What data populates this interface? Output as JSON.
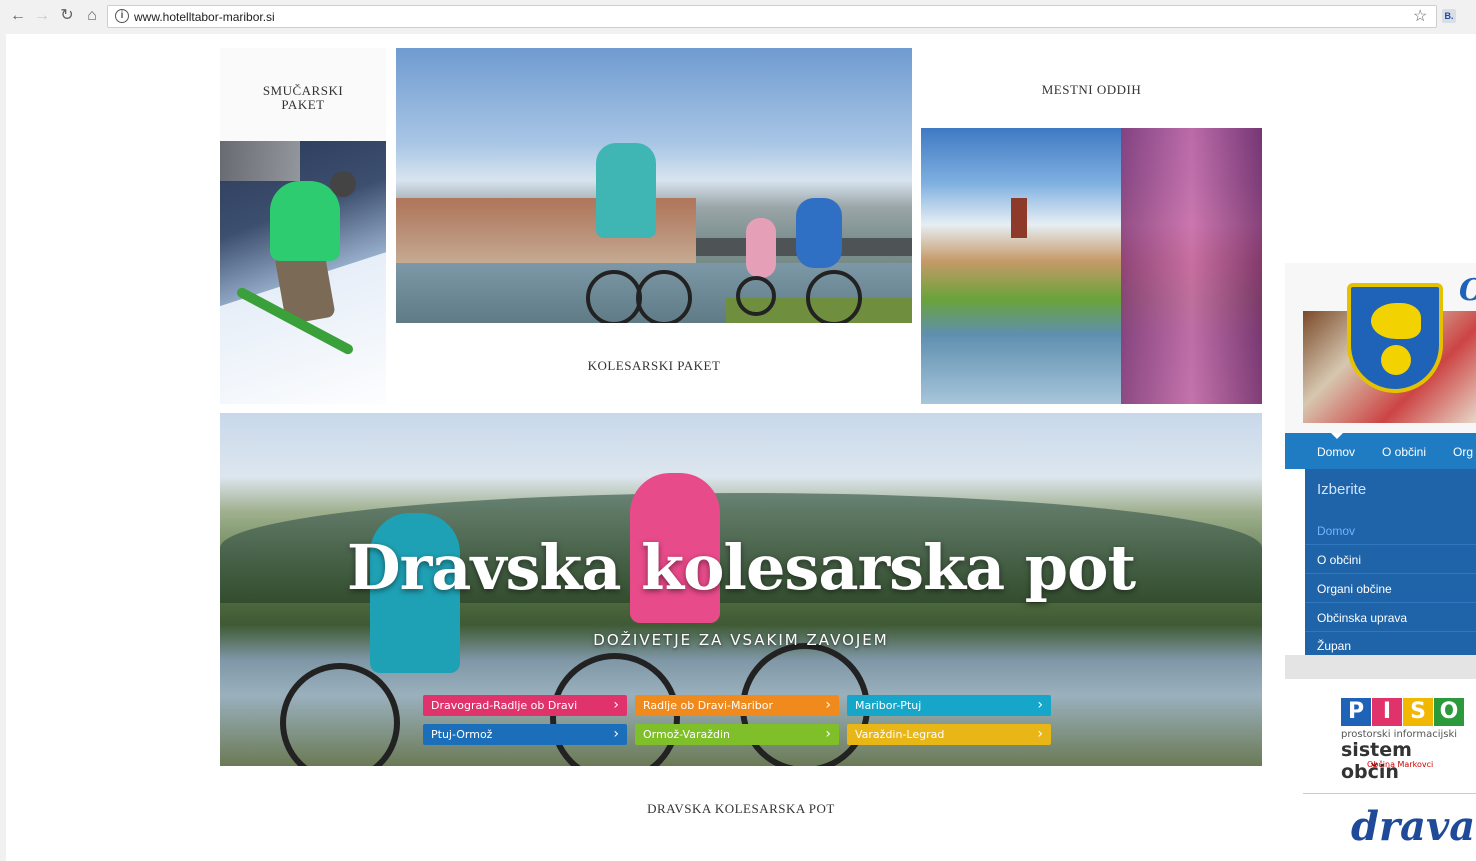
{
  "browser": {
    "url": "www.hotelltabor-maribor.si",
    "extension_label": "B."
  },
  "cards": {
    "ski": {
      "title": "SMUČARSKI\nPAKET"
    },
    "bike": {
      "title": "KOLESARSKI PAKET"
    },
    "town": {
      "title": "MESTNI ODDIH"
    },
    "drava": {
      "banner_title": "Dravska kolesarska pot",
      "banner_subtitle": "DOŽIVETJE ZA VSAKIM ZAVOJEM",
      "caption": "DRAVSKA KOLESARSKA POT",
      "routes": [
        {
          "label": "Dravograd-Radlje ob Dravi",
          "color": "#e0336b"
        },
        {
          "label": "Radlje ob Dravi-Maribor",
          "color": "#f08a1c"
        },
        {
          "label": "Maribor-Ptuj",
          "color": "#16a6c9"
        },
        {
          "label": "Ptuj-Ormož",
          "color": "#1b6fba"
        },
        {
          "label": "Ormož-Varaždin",
          "color": "#7fbf2a"
        },
        {
          "label": "Varaždin-Legrad",
          "color": "#e8b617"
        }
      ]
    }
  },
  "sidebar": {
    "header_letter": "O",
    "nav": [
      "Domov",
      "O občini",
      "Org"
    ],
    "menu_header": "Izberite",
    "menu_items": [
      {
        "label": "Domov",
        "active": true
      },
      {
        "label": "O občini",
        "active": false
      },
      {
        "label": "Organi občine",
        "active": false
      },
      {
        "label": "Občinska uprava",
        "active": false
      },
      {
        "label": "Župan",
        "active": false
      }
    ],
    "piso": {
      "letters": [
        "P",
        "I",
        "S",
        "O"
      ],
      "colors": [
        "#1f63b8",
        "#e0336b",
        "#f2b700",
        "#2a9a3a"
      ],
      "line1": "prostorski informacijski",
      "line2": "sistem občin",
      "line3": "Občina Markovci"
    },
    "drava_logo": "drava"
  }
}
